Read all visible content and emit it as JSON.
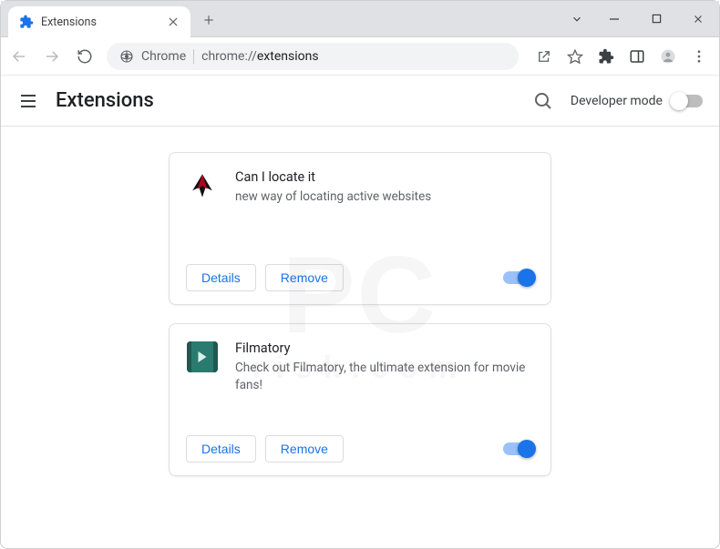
{
  "window": {
    "tab_title": "Extensions"
  },
  "omnibox": {
    "chip_label": "Chrome",
    "url_prefix": "chrome://",
    "url_path": "extensions"
  },
  "page_header": {
    "title": "Extensions",
    "developer_mode_label": "Developer mode",
    "developer_mode_on": false
  },
  "buttons": {
    "details": "Details",
    "remove": "Remove"
  },
  "extensions": [
    {
      "id": "can-i-locate-it",
      "name": "Can I locate it",
      "description": "new way of locating active websites",
      "enabled": true,
      "icon": "wings"
    },
    {
      "id": "filmatory",
      "name": "Filmatory",
      "description": "Check out Filmatory, the ultimate extension for movie fans!",
      "enabled": true,
      "icon": "film"
    }
  ],
  "watermark": {
    "main": "PC",
    "sub": "risk.com"
  }
}
